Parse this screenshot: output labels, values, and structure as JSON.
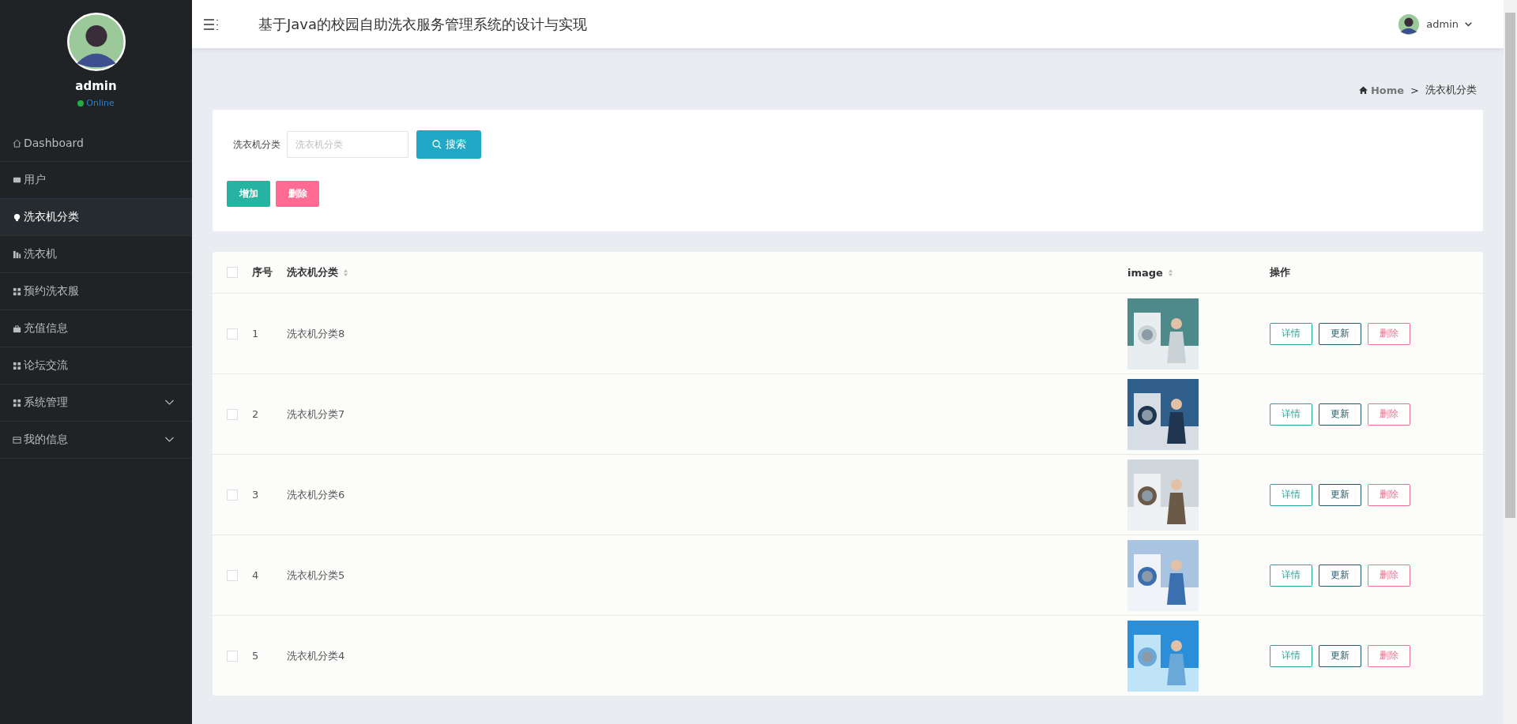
{
  "sidebar": {
    "user": {
      "name": "admin",
      "status": "Online"
    },
    "items": [
      {
        "label": "Dashboard",
        "kind": "link",
        "selected": false
      },
      {
        "label": "用户",
        "kind": "link",
        "selected": false
      },
      {
        "label": "洗衣机分类",
        "kind": "link",
        "selected": true
      },
      {
        "label": "洗衣机",
        "kind": "link",
        "selected": false
      },
      {
        "label": "预约洗衣服",
        "kind": "link",
        "selected": false
      },
      {
        "label": "充值信息",
        "kind": "link",
        "selected": false
      },
      {
        "label": "论坛交流",
        "kind": "link",
        "selected": false
      },
      {
        "label": "系统管理",
        "kind": "submenu",
        "selected": false
      },
      {
        "label": "我的信息",
        "kind": "submenu",
        "selected": false
      }
    ]
  },
  "header": {
    "title": "基于Java的校园自助洗衣服务管理系统的设计与实现",
    "user": "admin"
  },
  "breadcrumb": {
    "home": "Home",
    "separator": ">",
    "current": "洗衣机分类"
  },
  "search": {
    "label": "洗衣机分类",
    "placeholder": "洗衣机分类",
    "button": "搜索"
  },
  "actions": {
    "add": "增加",
    "delete": "删除"
  },
  "table": {
    "all_checked": false,
    "columns": [
      {
        "label": "序号",
        "sortable": false
      },
      {
        "label": "洗衣机分类",
        "sortable": true
      },
      {
        "label": "image",
        "sortable": true
      },
      {
        "label": "操作",
        "sortable": false
      }
    ],
    "rows": [
      {
        "index": "1",
        "name": "洗衣机分类8",
        "checked": false,
        "image": {
          "kind": "picture"
        },
        "buttons": [
          "详情",
          "更新",
          "删除"
        ]
      },
      {
        "index": "2",
        "name": "洗衣机分类7",
        "checked": false,
        "image": {
          "kind": "picture"
        },
        "buttons": [
          "详情",
          "更新",
          "删除"
        ]
      },
      {
        "index": "3",
        "name": "洗衣机分类6",
        "checked": false,
        "image": {
          "kind": "picture"
        },
        "buttons": [
          "详情",
          "更新",
          "删除"
        ]
      },
      {
        "index": "4",
        "name": "洗衣机分类5",
        "checked": false,
        "image": {
          "kind": "picture"
        },
        "buttons": [
          "详情",
          "更新",
          "删除"
        ]
      },
      {
        "index": "5",
        "name": "洗衣机分类4",
        "checked": false,
        "image": {
          "kind": "picture"
        },
        "buttons": [
          "详情",
          "更新",
          "删除"
        ]
      }
    ]
  }
}
